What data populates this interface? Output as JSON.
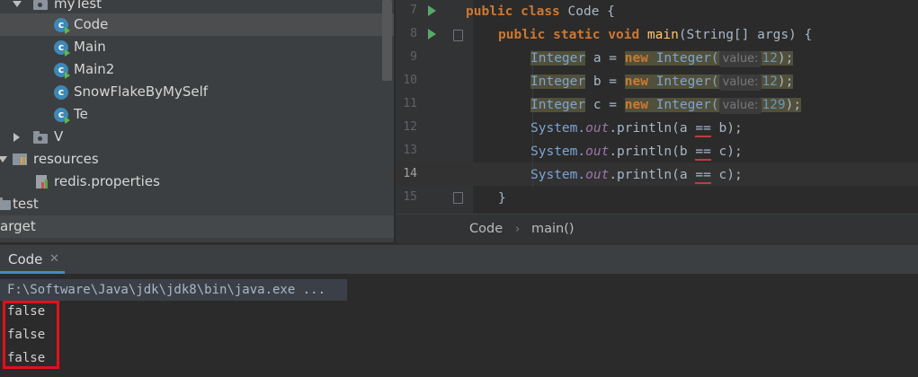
{
  "project_tree": {
    "items": [
      {
        "label": "myTest"
      },
      {
        "label": "Code"
      },
      {
        "label": "Main"
      },
      {
        "label": "Main2"
      },
      {
        "label": "SnowFlakeByMySelf"
      },
      {
        "label": "Te"
      },
      {
        "label": "V"
      },
      {
        "label": "resources"
      },
      {
        "label": "redis.properties"
      },
      {
        "label": "test"
      },
      {
        "label": "arget"
      }
    ]
  },
  "editor": {
    "line_numbers": [
      "7",
      "8",
      "9",
      "10",
      "11",
      "12",
      "13",
      "14",
      "15"
    ],
    "lines": {
      "l7": {
        "kw1": "public",
        "kw2": "class",
        "name": "Code",
        "brace": " {"
      },
      "l8": {
        "kw1": "public",
        "kw2": "static",
        "kw3": "void",
        "name": "main",
        "params": "(String[] args) {"
      },
      "l9": {
        "type": "Integer",
        "var": " a = ",
        "new": "new",
        "ctor": " Integer(",
        "hint": "value:",
        "num": "12",
        "end": ");"
      },
      "l10": {
        "type": "Integer",
        "var": " b = ",
        "new": "new",
        "ctor": " Integer(",
        "hint": "value:",
        "num": "12",
        "end": ");"
      },
      "l11": {
        "type": "Integer",
        "var": " c = ",
        "new": "new",
        "ctor": " Integer(",
        "hint": "value:",
        "num": "129",
        "end": ");"
      },
      "l12": {
        "sys": "System.",
        "out": "out",
        "call": ".println(a ",
        "eq": "==",
        "arg": " b);"
      },
      "l13": {
        "sys": "System.",
        "out": "out",
        "call": ".println(b ",
        "eq": "==",
        "arg": " c);"
      },
      "l14": {
        "sys": "System.",
        "out": "out",
        "call": ".println(a ",
        "eq": "==",
        "arg": " c);"
      },
      "l15": {
        "brace": "}"
      }
    }
  },
  "breadcrumb": {
    "items": [
      "Code",
      "main()"
    ],
    "separator": "›"
  },
  "run_panel": {
    "tab_label": "Code",
    "close": "✕",
    "command": "F:\\Software\\Java\\jdk\\jdk8\\bin\\java.exe ...",
    "output": [
      "false",
      "false",
      "false"
    ]
  },
  "colors": {
    "highlight_box": "#e0121b",
    "keyword": "#cc7832",
    "type": "#7ca4d4"
  }
}
